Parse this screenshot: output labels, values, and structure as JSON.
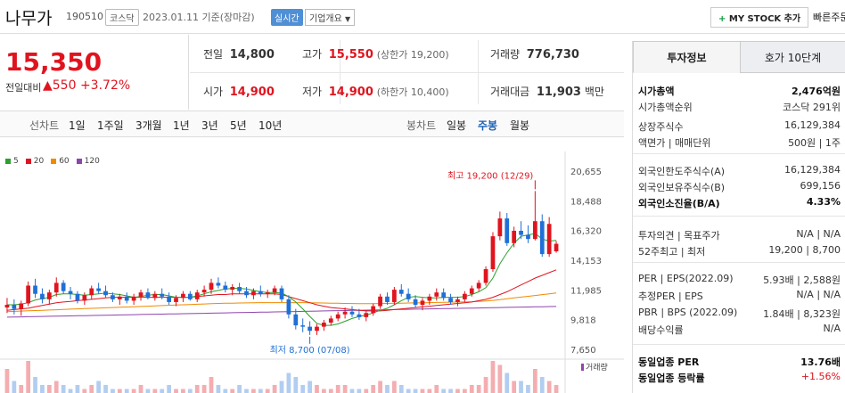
{
  "header": {
    "company": "나무가",
    "code": "190510",
    "market": "코스닥",
    "date_text": "2023.01.11 기준(장마감)",
    "live": "실시간",
    "company_info": "기업개요",
    "mystock": "MY STOCK 추가",
    "quick": "빠른주문"
  },
  "summary": {
    "price": "15,350",
    "compare_label": "전일대비",
    "change": "▲550",
    "change_pct": "+3.72%"
  },
  "stats": {
    "prev_label": "전일",
    "prev": "14,800",
    "high_label": "고가",
    "high": "15,550",
    "upper": "(상한가 19,200)",
    "volume_label": "거래량",
    "volume": "776,730",
    "open_label": "시가",
    "open": "14,900",
    "low_label": "저가",
    "low": "14,900",
    "lower": "(하한가 10,400)",
    "amount_label": "거래대금",
    "amount": "11,903",
    "amount_unit": "백만"
  },
  "periods": {
    "line_label": "선차트",
    "line": [
      "1일",
      "1주일",
      "3개월",
      "1년",
      "3년",
      "5년",
      "10년"
    ],
    "candle_label": "봉차트",
    "candle": [
      "일봉",
      "주봉",
      "월봉"
    ],
    "selected": "주봉"
  },
  "chart_data": {
    "type": "candlestick",
    "y_ticks": [
      "20,655",
      "18,488",
      "16,320",
      "14,153",
      "11,985",
      "9,818",
      "7,650"
    ],
    "ylim": [
      7650,
      20655
    ],
    "ma_legend": [
      {
        "name": "5",
        "color": "#2ca02c"
      },
      {
        "name": "20",
        "color": "#e0141e"
      },
      {
        "name": "60",
        "color": "#f08a00"
      },
      {
        "name": "120",
        "color": "#8e44ad"
      }
    ],
    "max_label": "최고 19,200 (12/29)",
    "min_label": "최저 8,700 (07/08)",
    "volume_label": "거래량",
    "candles": [
      [
        10700,
        11400,
        10300,
        10900
      ],
      [
        10900,
        11300,
        10200,
        10600
      ],
      [
        10600,
        11200,
        10100,
        11000
      ],
      [
        11000,
        12600,
        10800,
        12300
      ],
      [
        12300,
        12800,
        11400,
        11700
      ],
      [
        11700,
        12100,
        11000,
        11300
      ],
      [
        11300,
        12000,
        10900,
        11800
      ],
      [
        11800,
        12900,
        11500,
        12500
      ],
      [
        12500,
        12700,
        11700,
        11900
      ],
      [
        11900,
        12200,
        11300,
        11700
      ],
      [
        11700,
        11900,
        11000,
        11200
      ],
      [
        11200,
        11800,
        10900,
        11600
      ],
      [
        11600,
        12300,
        11300,
        12100
      ],
      [
        12100,
        12500,
        11700,
        11900
      ],
      [
        11900,
        12300,
        11400,
        11600
      ],
      [
        11600,
        11800,
        11100,
        11300
      ],
      [
        11300,
        11700,
        10900,
        11500
      ],
      [
        11500,
        11800,
        11000,
        11200
      ],
      [
        11200,
        11700,
        10900,
        11500
      ],
      [
        11500,
        12000,
        11200,
        11800
      ],
      [
        11800,
        12100,
        11300,
        11400
      ],
      [
        11400,
        11900,
        11200,
        11700
      ],
      [
        11700,
        12100,
        11300,
        11500
      ],
      [
        11500,
        11800,
        10900,
        11100
      ],
      [
        11100,
        11600,
        10800,
        11400
      ],
      [
        11400,
        11900,
        11100,
        11700
      ],
      [
        11700,
        11900,
        11200,
        11300
      ],
      [
        11300,
        12000,
        11100,
        11800
      ],
      [
        11800,
        12300,
        11500,
        12000
      ],
      [
        12000,
        12800,
        11700,
        12500
      ],
      [
        12500,
        12900,
        12100,
        12300
      ],
      [
        12300,
        12600,
        11800,
        12000
      ],
      [
        12000,
        12400,
        11600,
        12200
      ],
      [
        12200,
        12500,
        11700,
        11900
      ],
      [
        11900,
        12200,
        11400,
        11600
      ],
      [
        11600,
        12100,
        11300,
        11900
      ],
      [
        11900,
        12300,
        11500,
        11700
      ],
      [
        11700,
        12000,
        11400,
        11800
      ],
      [
        11800,
        12300,
        11600,
        12100
      ],
      [
        12100,
        12300,
        11100,
        11300
      ],
      [
        11300,
        11600,
        9900,
        10200
      ],
      [
        10200,
        10600,
        9100,
        9400
      ],
      [
        9400,
        9900,
        8900,
        9300
      ],
      [
        9300,
        9700,
        8700,
        9000
      ],
      [
        9000,
        9500,
        8700,
        9300
      ],
      [
        9300,
        9800,
        9000,
        9600
      ],
      [
        9600,
        10100,
        9400,
        9900
      ],
      [
        9900,
        10400,
        9700,
        10200
      ],
      [
        10200,
        10700,
        9900,
        10400
      ],
      [
        10400,
        10800,
        10000,
        10200
      ],
      [
        10200,
        10600,
        9800,
        10000
      ],
      [
        10000,
        10500,
        9700,
        10300
      ],
      [
        10300,
        11000,
        10100,
        10800
      ],
      [
        10800,
        11700,
        10600,
        11500
      ],
      [
        11500,
        11800,
        10900,
        11100
      ],
      [
        11100,
        12200,
        10900,
        12000
      ],
      [
        12000,
        12400,
        11500,
        11700
      ],
      [
        11700,
        12100,
        11100,
        11300
      ],
      [
        11300,
        11600,
        10700,
        10900
      ],
      [
        10900,
        11400,
        10500,
        11200
      ],
      [
        11200,
        11700,
        10900,
        11500
      ],
      [
        11500,
        12100,
        11200,
        11800
      ],
      [
        11800,
        12100,
        11200,
        11400
      ],
      [
        11400,
        11700,
        10900,
        11100
      ],
      [
        11100,
        11500,
        10800,
        11300
      ],
      [
        11300,
        11900,
        11100,
        11700
      ],
      [
        11700,
        12300,
        11500,
        12100
      ],
      [
        12100,
        12700,
        11900,
        12500
      ],
      [
        12500,
        13700,
        12300,
        13500
      ],
      [
        13500,
        16200,
        13300,
        15900
      ],
      [
        15900,
        17700,
        15600,
        17200
      ],
      [
        17200,
        17600,
        15200,
        15400
      ],
      [
        15400,
        16600,
        15100,
        16300
      ],
      [
        16300,
        17000,
        15700,
        16000
      ],
      [
        16000,
        16700,
        15400,
        15700
      ],
      [
        15700,
        19200,
        15600,
        17000
      ],
      [
        17000,
        17500,
        14400,
        14600
      ],
      [
        14600,
        17300,
        14400,
        16800
      ],
      [
        14800,
        15550,
        14700,
        15350
      ]
    ],
    "ma5": [
      10900,
      10900,
      10950,
      11050,
      11250,
      11350,
      11450,
      11650,
      11700,
      11700,
      11650,
      11600,
      11650,
      11700,
      11750,
      11700,
      11650,
      11550,
      11450,
      11500,
      11600,
      11650,
      11650,
      11550,
      11450,
      11450,
      11450,
      11550,
      11700,
      11850,
      11950,
      12050,
      12100,
      12100,
      12050,
      11950,
      11850,
      11800,
      11800,
      11750,
      11500,
      11100,
      10600,
      10050,
      9550,
      9400,
      9400,
      9500,
      9700,
      9900,
      10050,
      10150,
      10300,
      10500,
      10650,
      10900,
      11200,
      11450,
      11500,
      11450,
      11400,
      11400,
      11450,
      11450,
      11450,
      11500,
      11650,
      11850,
      12150,
      12850,
      13900,
      14700,
      15400,
      15900,
      16000,
      16100,
      15700,
      15550,
      15600
    ],
    "ma20": [
      10500,
      10550,
      10600,
      10650,
      10750,
      10850,
      10950,
      11050,
      11100,
      11150,
      11200,
      11250,
      11300,
      11350,
      11400,
      11450,
      11450,
      11450,
      11450,
      11450,
      11450,
      11450,
      11450,
      11450,
      11450,
      11450,
      11450,
      11500,
      11550,
      11600,
      11650,
      11650,
      11700,
      11700,
      11700,
      11700,
      11700,
      11700,
      11700,
      11650,
      11500,
      11350,
      11200,
      11050,
      10900,
      10800,
      10700,
      10650,
      10600,
      10550,
      10500,
      10450,
      10450,
      10450,
      10500,
      10550,
      10600,
      10650,
      10700,
      10750,
      10800,
      10850,
      10900,
      10950,
      11000,
      11050,
      11100,
      11200,
      11300,
      11450,
      11650,
      11850,
      12100,
      12350,
      12600,
      12850,
      13050,
      13250,
      13450
    ],
    "ma60": [
      10400,
      10420,
      10440,
      10460,
      10480,
      10500,
      10520,
      10540,
      10560,
      10580,
      10600,
      10620,
      10640,
      10660,
      10680,
      10700,
      10720,
      10740,
      10760,
      10780,
      10800,
      10820,
      10840,
      10860,
      10880,
      10900,
      10920,
      10940,
      10960,
      10980,
      11000,
      11010,
      11020,
      11030,
      11040,
      11050,
      11060,
      11060,
      11060,
      11060,
      11060,
      11060,
      11060,
      11050,
      11040,
      11030,
      11020,
      11010,
      11000,
      10990,
      10980,
      10980,
      10980,
      10990,
      11000,
      11010,
      11020,
      11030,
      11040,
      11050,
      11060,
      11070,
      11080,
      11090,
      11100,
      11110,
      11120,
      11150,
      11180,
      11220,
      11280,
      11340,
      11400,
      11460,
      11520,
      11580,
      11640,
      11700,
      11760
    ],
    "ma120": [
      10000,
      10010,
      10020,
      10030,
      10040,
      10050,
      10060,
      10070,
      10080,
      10090,
      10100,
      10110,
      10120,
      10130,
      10140,
      10150,
      10160,
      10170,
      10180,
      10190,
      10200,
      10210,
      10220,
      10230,
      10240,
      10250,
      10260,
      10270,
      10280,
      10290,
      10300,
      10310,
      10320,
      10330,
      10340,
      10350,
      10360,
      10370,
      10380,
      10390,
      10400,
      10410,
      10420,
      10430,
      10440,
      10450,
      10460,
      10470,
      10480,
      10490,
      10500,
      10510,
      10520,
      10530,
      10540,
      10550,
      10560,
      10570,
      10580,
      10590,
      10600,
      10610,
      10620,
      10630,
      10640,
      10650,
      10660,
      10670,
      10680,
      10690,
      10700,
      10710,
      10720,
      10730,
      10740,
      10750,
      10760,
      10770,
      10780
    ],
    "volume": [
      6,
      3,
      2,
      8,
      4,
      2,
      2,
      3,
      2,
      1,
      2,
      1,
      2,
      3,
      2,
      1,
      1,
      1,
      1,
      2,
      1,
      1,
      1,
      2,
      1,
      1,
      1,
      2,
      2,
      4,
      2,
      1,
      1,
      2,
      1,
      1,
      1,
      1,
      2,
      3,
      5,
      4,
      2,
      3,
      2,
      1,
      1,
      2,
      2,
      1,
      1,
      1,
      2,
      3,
      2,
      3,
      2,
      1,
      1,
      1,
      1,
      2,
      1,
      1,
      1,
      1,
      2,
      2,
      4,
      8,
      7,
      5,
      3,
      3,
      2,
      6,
      4,
      3,
      2
    ]
  },
  "side": {
    "tabs": [
      "투자정보",
      "호가 10단계"
    ],
    "rows": [
      {
        "k": "시가총액",
        "v": "2,476억원"
      },
      {
        "k": "시가총액순위",
        "v": "코스닥 291위"
      },
      {
        "k": "상장주식수",
        "v": "16,129,384"
      },
      {
        "k": "액면가 | 매매단위",
        "v": "500원 | 1주"
      },
      {
        "k": "외국인한도주식수(A)",
        "v": "16,129,384"
      },
      {
        "k": "외국인보유주식수(B)",
        "v": "699,156"
      },
      {
        "k": "외국인소진율(B/A)",
        "v": "4.33%"
      },
      {
        "k": "투자의견 | 목표주가",
        "v": "N/A | N/A"
      },
      {
        "k": "52주최고 | 최저",
        "v": "19,200 | 8,700"
      },
      {
        "k": "PER | EPS(2022.09)",
        "v": "5.93배 | 2,588원"
      },
      {
        "k": "추정PER | EPS",
        "v": "N/A | N/A"
      },
      {
        "k": "PBR | BPS (2022.09)",
        "v": "1.84배 | 8,323원"
      },
      {
        "k": "배당수익률",
        "v": "N/A"
      },
      {
        "k": "동일업종 PER",
        "v": "13.76배"
      },
      {
        "k": "동일업종 등락률",
        "v": "+1.56%"
      }
    ]
  }
}
